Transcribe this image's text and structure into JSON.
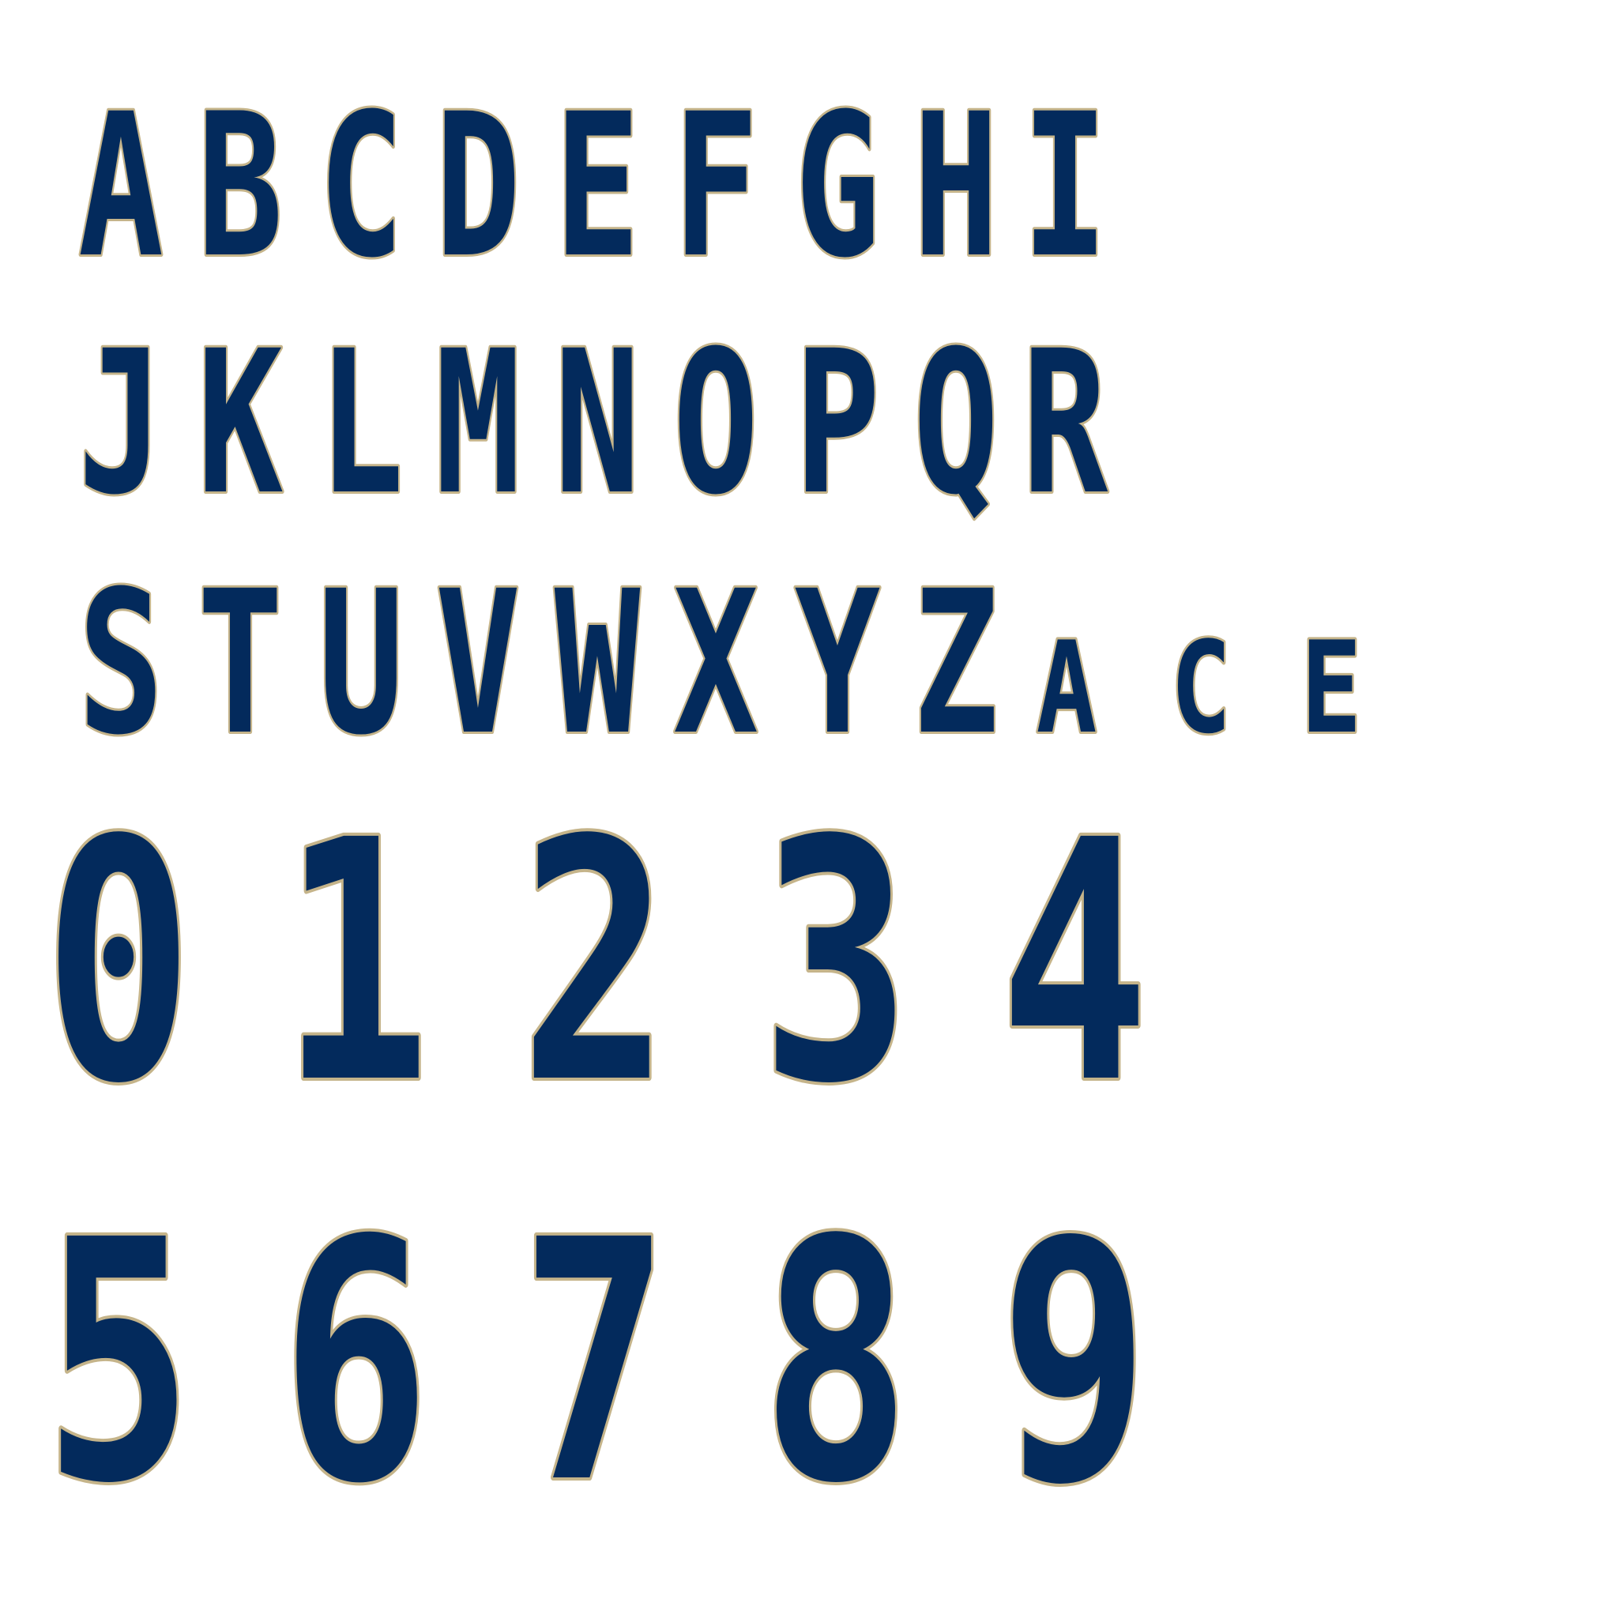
{
  "specimen": {
    "colors": {
      "fill": "#032a5c",
      "outline": "#c5b48a",
      "background": "#ffffff"
    },
    "rows": [
      {
        "name": "letters-a-i",
        "style": "letter",
        "glyphs": [
          "A",
          "B",
          "C",
          "D",
          "E",
          "F",
          "G",
          "H",
          "I"
        ]
      },
      {
        "name": "letters-j-r",
        "style": "letter",
        "glyphs": [
          "J",
          "K",
          "L",
          "M",
          "N",
          "O",
          "P",
          "Q",
          "R"
        ]
      },
      {
        "name": "letters-s-z",
        "style": "letter",
        "glyphs": [
          "S",
          "T",
          "U",
          "V",
          "W",
          "X",
          "Y",
          "Z"
        ]
      },
      {
        "name": "small-caps",
        "style": "small-cap",
        "glyphs": [
          "A",
          "C",
          "E"
        ]
      },
      {
        "name": "numerals-0-4",
        "style": "numeral",
        "glyphs": [
          "0",
          "1",
          "2",
          "3",
          "4"
        ]
      },
      {
        "name": "numerals-5-9",
        "style": "numeral",
        "glyphs": [
          "5",
          "6",
          "7",
          "8",
          "9"
        ]
      }
    ]
  }
}
